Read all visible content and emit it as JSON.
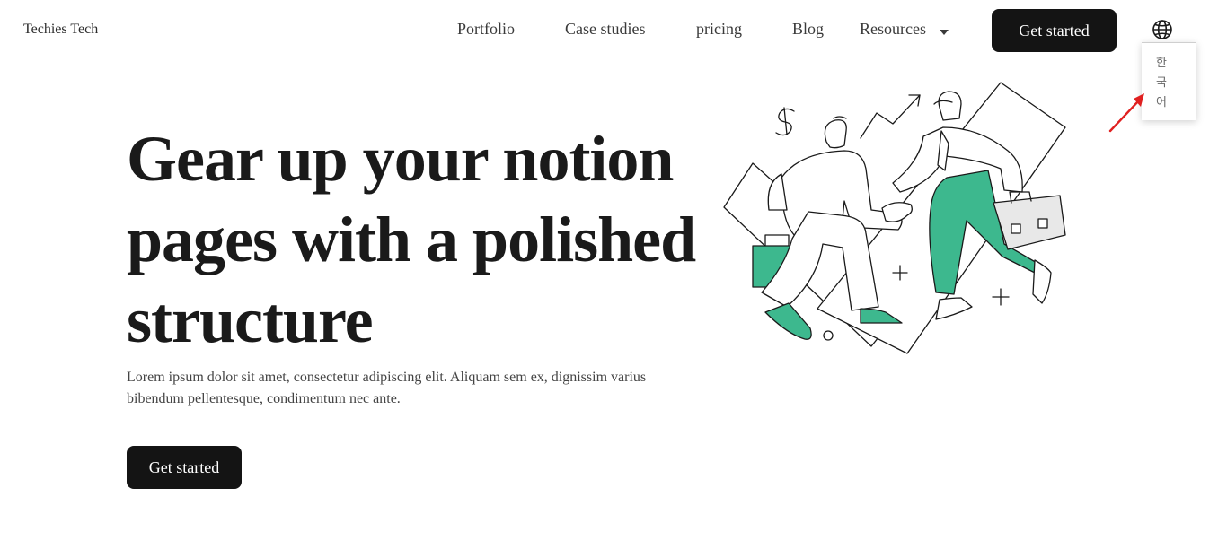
{
  "header": {
    "brand": "Techies Tech",
    "nav": [
      {
        "label": "Portfolio"
      },
      {
        "label": "Case studies"
      },
      {
        "label": "pricing"
      },
      {
        "label": "Blog"
      },
      {
        "label": "Resources"
      }
    ],
    "resources_icon": "chevron-down-icon",
    "cta_label": "Get started",
    "language_icon": "globe-icon",
    "language_menu": {
      "options": [
        "한국어"
      ]
    }
  },
  "hero": {
    "title": "Gear up your notion pages with a polished structure",
    "subtitle": "Lorem ipsum dolor sit amet, consectetur adipiscing elit. Aliquam sem ex, dignissim varius bibendum pellentesque, condimentum nec ante.",
    "cta_label": "Get started",
    "illustration": "handshake-illustration"
  },
  "annotation": {
    "icon": "red-arrow-icon",
    "color": "#e02020"
  },
  "colors": {
    "accent_green": "#3db88e",
    "button_bg": "#141414",
    "text": "#1a1a1a"
  }
}
